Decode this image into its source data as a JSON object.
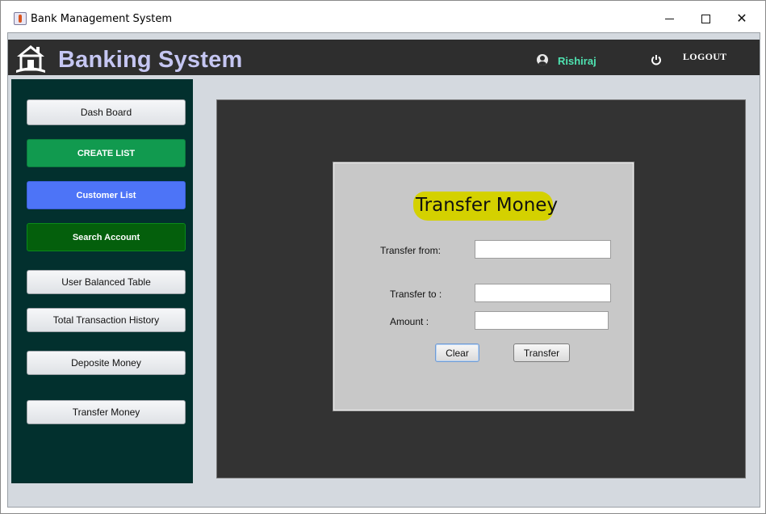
{
  "window": {
    "title": "Bank Management System",
    "controls": {
      "minimize": "minimize",
      "maximize": "maximize",
      "close": "✕"
    }
  },
  "header": {
    "brand": "Banking System",
    "user_name": "Rishiraj",
    "logout_label": "LOGOUT",
    "icons": [
      "bank-logo-icon",
      "user-icon",
      "power-icon"
    ]
  },
  "sidebar": {
    "items": [
      {
        "label": "Dash Board",
        "style": "light"
      },
      {
        "label": "CREATE LIST",
        "style": "green"
      },
      {
        "label": "Customer List",
        "style": "blue"
      },
      {
        "label": "Search Account",
        "style": "dark-green"
      },
      {
        "label": "User Balanced Table",
        "style": "light"
      },
      {
        "label": "Total Transaction History",
        "style": "light"
      },
      {
        "label": "Deposite Money",
        "style": "light"
      },
      {
        "label": "Transfer Money",
        "style": "light"
      }
    ]
  },
  "form": {
    "title": "Transfer Money",
    "fields": {
      "from": {
        "label": "Transfer from:",
        "value": ""
      },
      "to": {
        "label": "Transfer to :",
        "value": ""
      },
      "amount": {
        "label": "Amount :",
        "value": ""
      }
    },
    "buttons": {
      "clear": "Clear",
      "transfer": "Transfer"
    }
  },
  "colors": {
    "header_bg": "#2e2e2e",
    "brand_text": "#c5c6f2",
    "user_name": "#4fe3b1",
    "sidebar_bg": "#02302e",
    "main_panel_bg": "#333333",
    "form_bg": "#c8c8c8",
    "title_highlight": "#d4d100",
    "create_list": "#119a4f",
    "customer_list": "#4d74f7",
    "search_account": "#045f0c"
  }
}
